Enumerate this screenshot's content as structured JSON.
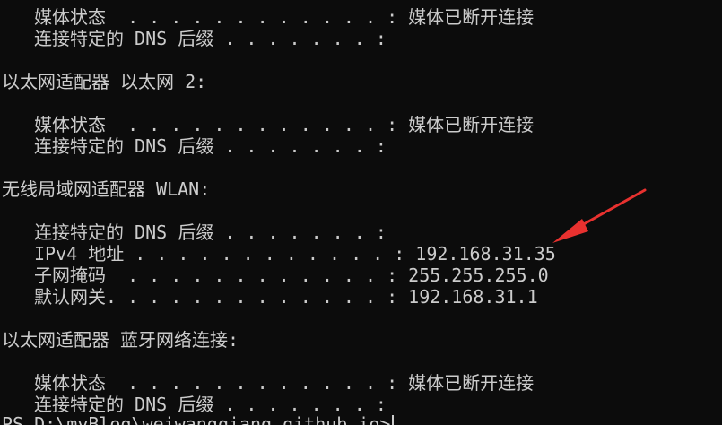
{
  "terminal": {
    "lines": [
      "媒体状态  . . . . . . . . . . . . : 媒体已断开连接",
      "连接特定的 DNS 后缀 . . . . . . . :",
      "",
      "以太网适配器 以太网 2:",
      "",
      "媒体状态  . . . . . . . . . . . . : 媒体已断开连接",
      "连接特定的 DNS 后缀 . . . . . . . :",
      "",
      "无线局域网适配器 WLAN:",
      "",
      "连接特定的 DNS 后缀 . . . . . . . :",
      "IPv4 地址 . . . . . . . . . . . . : 192.168.31.35",
      "子网掩码  . . . . . . . . . . . . : 255.255.255.0",
      "默认网关. . . . . . . . . . . . . : 192.168.31.1",
      "",
      "以太网适配器 蓝牙网络连接:",
      "",
      "媒体状态  . . . . . . . . . . . . : 媒体已断开连接",
      "连接特定的 DNS 后缀 . . . . . . . :",
      "PS D:\\myBlog\\weiwangqiang.github.io>"
    ]
  },
  "annotation": {
    "arrow_color": "#e8312f"
  }
}
